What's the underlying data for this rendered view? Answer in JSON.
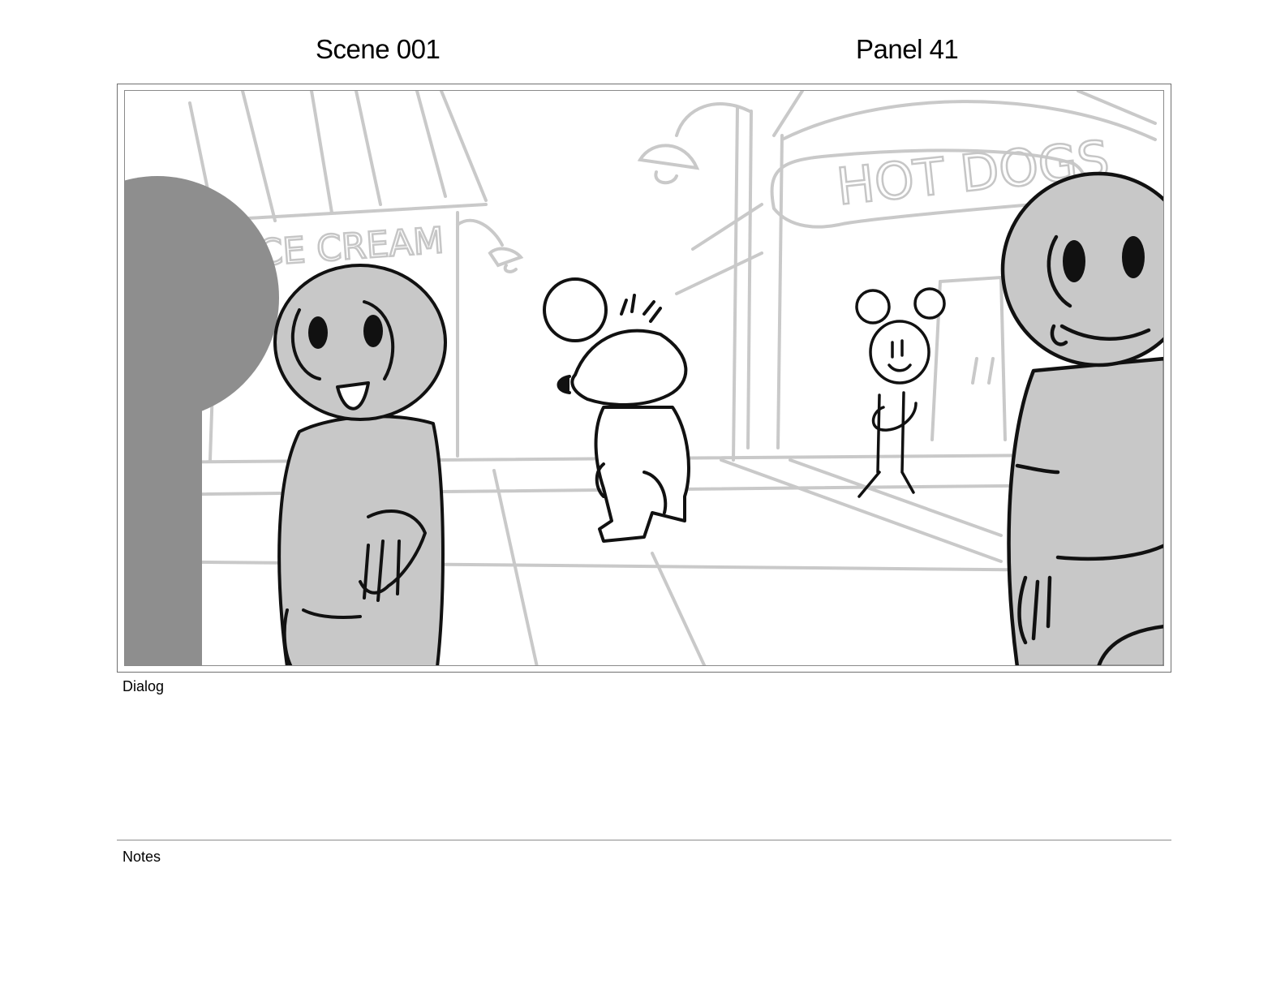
{
  "header": {
    "scene_label": "Scene 001",
    "panel_label": "Panel 41"
  },
  "panel_art": {
    "sign_ice_cream": "CE CREAM",
    "sign_hot_dogs": "HOT DOGS"
  },
  "sections": {
    "dialog_label": "Dialog",
    "dialog_text": "",
    "notes_label": "Notes",
    "notes_text": ""
  }
}
